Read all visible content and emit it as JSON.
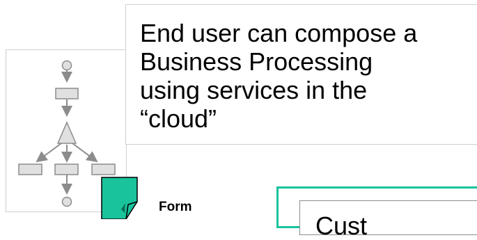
{
  "caption": {
    "line1": "End user can compose a",
    "line2": "Business Processing",
    "line3": "using services in the",
    "line4": "“cloud”"
  },
  "form_label": "Form",
  "inner_box_label": "Cust",
  "colors": {
    "teal": "#19c39c",
    "node_fill": "#e0e0e0",
    "node_stroke": "#8c8c8c",
    "panel_border": "#cfcfcf"
  }
}
